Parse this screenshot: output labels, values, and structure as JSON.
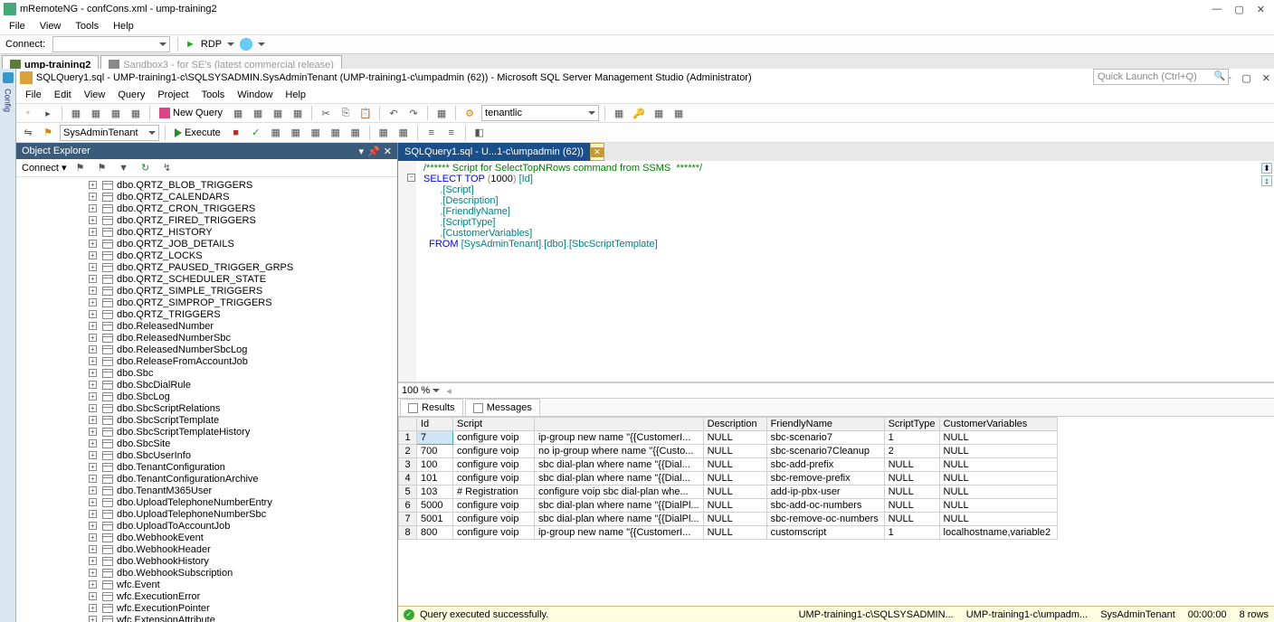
{
  "outer": {
    "title": "mRemoteNG - confCons.xml - ump-training2",
    "menus": [
      "File",
      "View",
      "Tools",
      "Help"
    ],
    "connect_label": "Connect:",
    "rdp_label": "RDP",
    "tabs": [
      {
        "label": "ump-training2",
        "active": true
      },
      {
        "label": "Sandbox3 - for SE's (latest commercial release)",
        "active": false
      }
    ]
  },
  "ssms": {
    "title": "SQLQuery1.sql - UMP-training1-c\\SQLSYSADMIN.SysAdminTenant (UMP-training1-c\\umpadmin (62)) - Microsoft SQL Server Management Studio (Administrator)",
    "menus": [
      "File",
      "Edit",
      "View",
      "Query",
      "Project",
      "Tools",
      "Window",
      "Help"
    ],
    "quick_launch_ph": "Quick Launch (Ctrl+Q)",
    "new_query": "New Query",
    "dd1": "tenantlic",
    "db_dd": "SysAdminTenant",
    "execute": "Execute",
    "oe_title": "Object Explorer",
    "oe_connect": "Connect",
    "doc_tab": "SQLQuery1.sql - U...1-c\\umpadmin (62))",
    "zoom": "100 %",
    "results_tab": "Results",
    "messages_tab": "Messages",
    "status_msg": "Query executed successfully.",
    "status_right": [
      "UMP-training1-c\\SQLSYSADMIN...",
      "UMP-training1-c\\umpadm...",
      "SysAdminTenant",
      "00:00:00",
      "8 rows"
    ]
  },
  "tree": [
    "dbo.QRTZ_BLOB_TRIGGERS",
    "dbo.QRTZ_CALENDARS",
    "dbo.QRTZ_CRON_TRIGGERS",
    "dbo.QRTZ_FIRED_TRIGGERS",
    "dbo.QRTZ_HISTORY",
    "dbo.QRTZ_JOB_DETAILS",
    "dbo.QRTZ_LOCKS",
    "dbo.QRTZ_PAUSED_TRIGGER_GRPS",
    "dbo.QRTZ_SCHEDULER_STATE",
    "dbo.QRTZ_SIMPLE_TRIGGERS",
    "dbo.QRTZ_SIMPROP_TRIGGERS",
    "dbo.QRTZ_TRIGGERS",
    "dbo.ReleasedNumber",
    "dbo.ReleasedNumberSbc",
    "dbo.ReleasedNumberSbcLog",
    "dbo.ReleaseFromAccountJob",
    "dbo.Sbc",
    "dbo.SbcDialRule",
    "dbo.SbcLog",
    "dbo.SbcScriptRelations",
    "dbo.SbcScriptTemplate",
    "dbo.SbcScriptTemplateHistory",
    "dbo.SbcSite",
    "dbo.SbcUserInfo",
    "dbo.TenantConfiguration",
    "dbo.TenantConfigurationArchive",
    "dbo.TenantM365User",
    "dbo.UploadTelephoneNumberEntry",
    "dbo.UploadTelephoneNumberSbc",
    "dbo.UploadToAccountJob",
    "dbo.WebhookEvent",
    "dbo.WebhookHeader",
    "dbo.WebhookHistory",
    "dbo.WebhookSubscription",
    "wfc.Event",
    "wfc.ExecutionError",
    "wfc.ExecutionPointer",
    "wfc.ExtensionAttribute"
  ],
  "sql_lines": [
    {
      "t": "cm",
      "v": "/****** Script for SelectTopNRows command from SSMS  ******/"
    },
    {
      "t": "sel",
      "v": "SELECT TOP (1000) [Id]"
    },
    {
      "t": "col",
      "v": "      ,[Script]"
    },
    {
      "t": "col",
      "v": "      ,[Description]"
    },
    {
      "t": "col",
      "v": "      ,[FriendlyName]"
    },
    {
      "t": "col",
      "v": "      ,[ScriptType]"
    },
    {
      "t": "col",
      "v": "      ,[CustomerVariables]"
    },
    {
      "t": "from",
      "v": "  FROM [SysAdminTenant].[dbo].[SbcScriptTemplate]"
    }
  ],
  "grid": {
    "headers": [
      "",
      "Id",
      "Script",
      "",
      "Description",
      "FriendlyName",
      "ScriptType",
      "CustomerVariables"
    ],
    "rows": [
      [
        "1",
        "7",
        "configure voip",
        "ip-group new    name \"{{CustomerI...",
        "NULL",
        "sbc-scenario7",
        "1",
        "NULL"
      ],
      [
        "2",
        "700",
        "configure voip",
        "no ip-group where name \"{{Custo...",
        "NULL",
        "sbc-scenario7Cleanup",
        "2",
        "NULL"
      ],
      [
        "3",
        "100",
        "configure voip",
        "sbc dial-plan where name \"{{Dial...",
        "NULL",
        "sbc-add-prefix",
        "NULL",
        "NULL"
      ],
      [
        "4",
        "101",
        "configure voip",
        "sbc dial-plan where name \"{{Dial...",
        "NULL",
        "sbc-remove-prefix",
        "NULL",
        "NULL"
      ],
      [
        "5",
        "103",
        "# Registration",
        "configure voip    sbc dial-plan whe...",
        "NULL",
        "add-ip-pbx-user",
        "NULL",
        "NULL"
      ],
      [
        "6",
        "5000",
        "configure voip",
        "sbc dial-plan where name \"{{DialPl...",
        "NULL",
        "sbc-add-oc-numbers",
        "NULL",
        "NULL"
      ],
      [
        "7",
        "5001",
        "configure voip",
        "sbc dial-plan where name \"{{DialPl...",
        "NULL",
        "sbc-remove-oc-numbers",
        "NULL",
        "NULL"
      ],
      [
        "8",
        "800",
        "configure voip",
        "ip-group new    name \"{{CustomerI...",
        "NULL",
        "customscript",
        "1",
        "localhostname,variable2"
      ]
    ]
  }
}
